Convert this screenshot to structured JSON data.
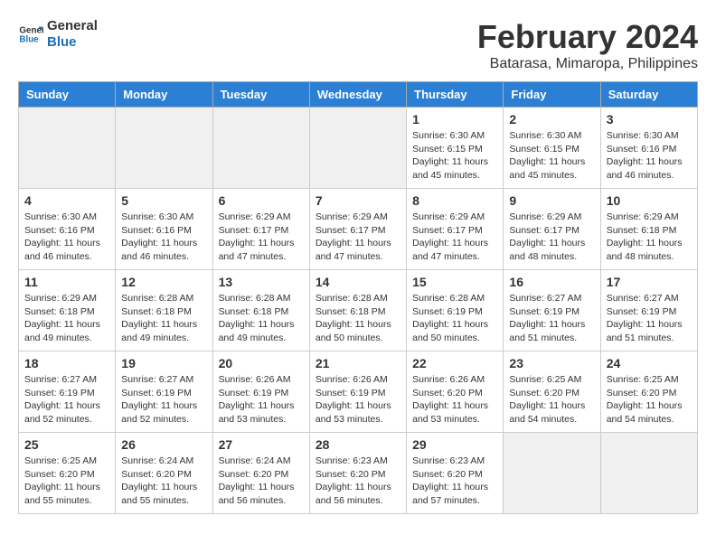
{
  "header": {
    "logo_line1": "General",
    "logo_line2": "Blue",
    "month": "February 2024",
    "location": "Batarasa, Mimaropa, Philippines"
  },
  "days_of_week": [
    "Sunday",
    "Monday",
    "Tuesday",
    "Wednesday",
    "Thursday",
    "Friday",
    "Saturday"
  ],
  "weeks": [
    [
      {
        "day": "",
        "info": ""
      },
      {
        "day": "",
        "info": ""
      },
      {
        "day": "",
        "info": ""
      },
      {
        "day": "",
        "info": ""
      },
      {
        "day": "1",
        "info": "Sunrise: 6:30 AM\nSunset: 6:15 PM\nDaylight: 11 hours and 45 minutes."
      },
      {
        "day": "2",
        "info": "Sunrise: 6:30 AM\nSunset: 6:15 PM\nDaylight: 11 hours and 45 minutes."
      },
      {
        "day": "3",
        "info": "Sunrise: 6:30 AM\nSunset: 6:16 PM\nDaylight: 11 hours and 46 minutes."
      }
    ],
    [
      {
        "day": "4",
        "info": "Sunrise: 6:30 AM\nSunset: 6:16 PM\nDaylight: 11 hours and 46 minutes."
      },
      {
        "day": "5",
        "info": "Sunrise: 6:30 AM\nSunset: 6:16 PM\nDaylight: 11 hours and 46 minutes."
      },
      {
        "day": "6",
        "info": "Sunrise: 6:29 AM\nSunset: 6:17 PM\nDaylight: 11 hours and 47 minutes."
      },
      {
        "day": "7",
        "info": "Sunrise: 6:29 AM\nSunset: 6:17 PM\nDaylight: 11 hours and 47 minutes."
      },
      {
        "day": "8",
        "info": "Sunrise: 6:29 AM\nSunset: 6:17 PM\nDaylight: 11 hours and 47 minutes."
      },
      {
        "day": "9",
        "info": "Sunrise: 6:29 AM\nSunset: 6:17 PM\nDaylight: 11 hours and 48 minutes."
      },
      {
        "day": "10",
        "info": "Sunrise: 6:29 AM\nSunset: 6:18 PM\nDaylight: 11 hours and 48 minutes."
      }
    ],
    [
      {
        "day": "11",
        "info": "Sunrise: 6:29 AM\nSunset: 6:18 PM\nDaylight: 11 hours and 49 minutes."
      },
      {
        "day": "12",
        "info": "Sunrise: 6:28 AM\nSunset: 6:18 PM\nDaylight: 11 hours and 49 minutes."
      },
      {
        "day": "13",
        "info": "Sunrise: 6:28 AM\nSunset: 6:18 PM\nDaylight: 11 hours and 49 minutes."
      },
      {
        "day": "14",
        "info": "Sunrise: 6:28 AM\nSunset: 6:18 PM\nDaylight: 11 hours and 50 minutes."
      },
      {
        "day": "15",
        "info": "Sunrise: 6:28 AM\nSunset: 6:19 PM\nDaylight: 11 hours and 50 minutes."
      },
      {
        "day": "16",
        "info": "Sunrise: 6:27 AM\nSunset: 6:19 PM\nDaylight: 11 hours and 51 minutes."
      },
      {
        "day": "17",
        "info": "Sunrise: 6:27 AM\nSunset: 6:19 PM\nDaylight: 11 hours and 51 minutes."
      }
    ],
    [
      {
        "day": "18",
        "info": "Sunrise: 6:27 AM\nSunset: 6:19 PM\nDaylight: 11 hours and 52 minutes."
      },
      {
        "day": "19",
        "info": "Sunrise: 6:27 AM\nSunset: 6:19 PM\nDaylight: 11 hours and 52 minutes."
      },
      {
        "day": "20",
        "info": "Sunrise: 6:26 AM\nSunset: 6:19 PM\nDaylight: 11 hours and 53 minutes."
      },
      {
        "day": "21",
        "info": "Sunrise: 6:26 AM\nSunset: 6:19 PM\nDaylight: 11 hours and 53 minutes."
      },
      {
        "day": "22",
        "info": "Sunrise: 6:26 AM\nSunset: 6:20 PM\nDaylight: 11 hours and 53 minutes."
      },
      {
        "day": "23",
        "info": "Sunrise: 6:25 AM\nSunset: 6:20 PM\nDaylight: 11 hours and 54 minutes."
      },
      {
        "day": "24",
        "info": "Sunrise: 6:25 AM\nSunset: 6:20 PM\nDaylight: 11 hours and 54 minutes."
      }
    ],
    [
      {
        "day": "25",
        "info": "Sunrise: 6:25 AM\nSunset: 6:20 PM\nDaylight: 11 hours and 55 minutes."
      },
      {
        "day": "26",
        "info": "Sunrise: 6:24 AM\nSunset: 6:20 PM\nDaylight: 11 hours and 55 minutes."
      },
      {
        "day": "27",
        "info": "Sunrise: 6:24 AM\nSunset: 6:20 PM\nDaylight: 11 hours and 56 minutes."
      },
      {
        "day": "28",
        "info": "Sunrise: 6:23 AM\nSunset: 6:20 PM\nDaylight: 11 hours and 56 minutes."
      },
      {
        "day": "29",
        "info": "Sunrise: 6:23 AM\nSunset: 6:20 PM\nDaylight: 11 hours and 57 minutes."
      },
      {
        "day": "",
        "info": ""
      },
      {
        "day": "",
        "info": ""
      }
    ]
  ]
}
